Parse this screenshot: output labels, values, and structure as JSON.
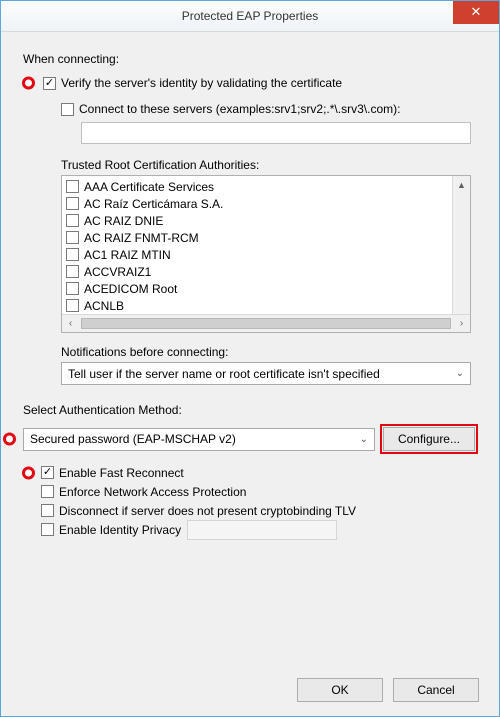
{
  "window": {
    "title": "Protected EAP Properties",
    "close_glyph": "✕"
  },
  "labels": {
    "when_connecting": "When connecting:",
    "verify_identity": "Verify the server's identity by validating the certificate",
    "connect_servers": "Connect to these servers (examples:srv1;srv2;.*\\.srv3\\.com):",
    "trusted_root": "Trusted Root Certification Authorities:",
    "notifications": "Notifications before connecting:",
    "select_auth": "Select Authentication Method:",
    "configure": "Configure...",
    "enable_fast": "Enable Fast Reconnect",
    "enforce_nap": "Enforce Network Access Protection",
    "disconnect_crypto": "Disconnect if server does not present cryptobinding TLV",
    "enable_identity": "Enable Identity Privacy",
    "ok": "OK",
    "cancel": "Cancel"
  },
  "checks": {
    "verify_identity": true,
    "connect_servers": false,
    "enable_fast": true,
    "enforce_nap": false,
    "disconnect_crypto": false,
    "enable_identity": false
  },
  "cert_list": [
    "AAA Certificate Services",
    "AC Raíz Certicámara S.A.",
    "AC RAIZ DNIE",
    "AC RAIZ FNMT-RCM",
    "AC1 RAIZ MTIN",
    "ACCVRAIZ1",
    "ACEDICOM Root",
    "ACNLB"
  ],
  "notifications_value": "Tell user if the server name or root certificate isn't specified",
  "auth_method_value": "Secured password (EAP-MSCHAP v2)",
  "scroll": {
    "up": "▲",
    "down": "▼",
    "left": "‹",
    "right": "›",
    "dd": "⌄"
  }
}
